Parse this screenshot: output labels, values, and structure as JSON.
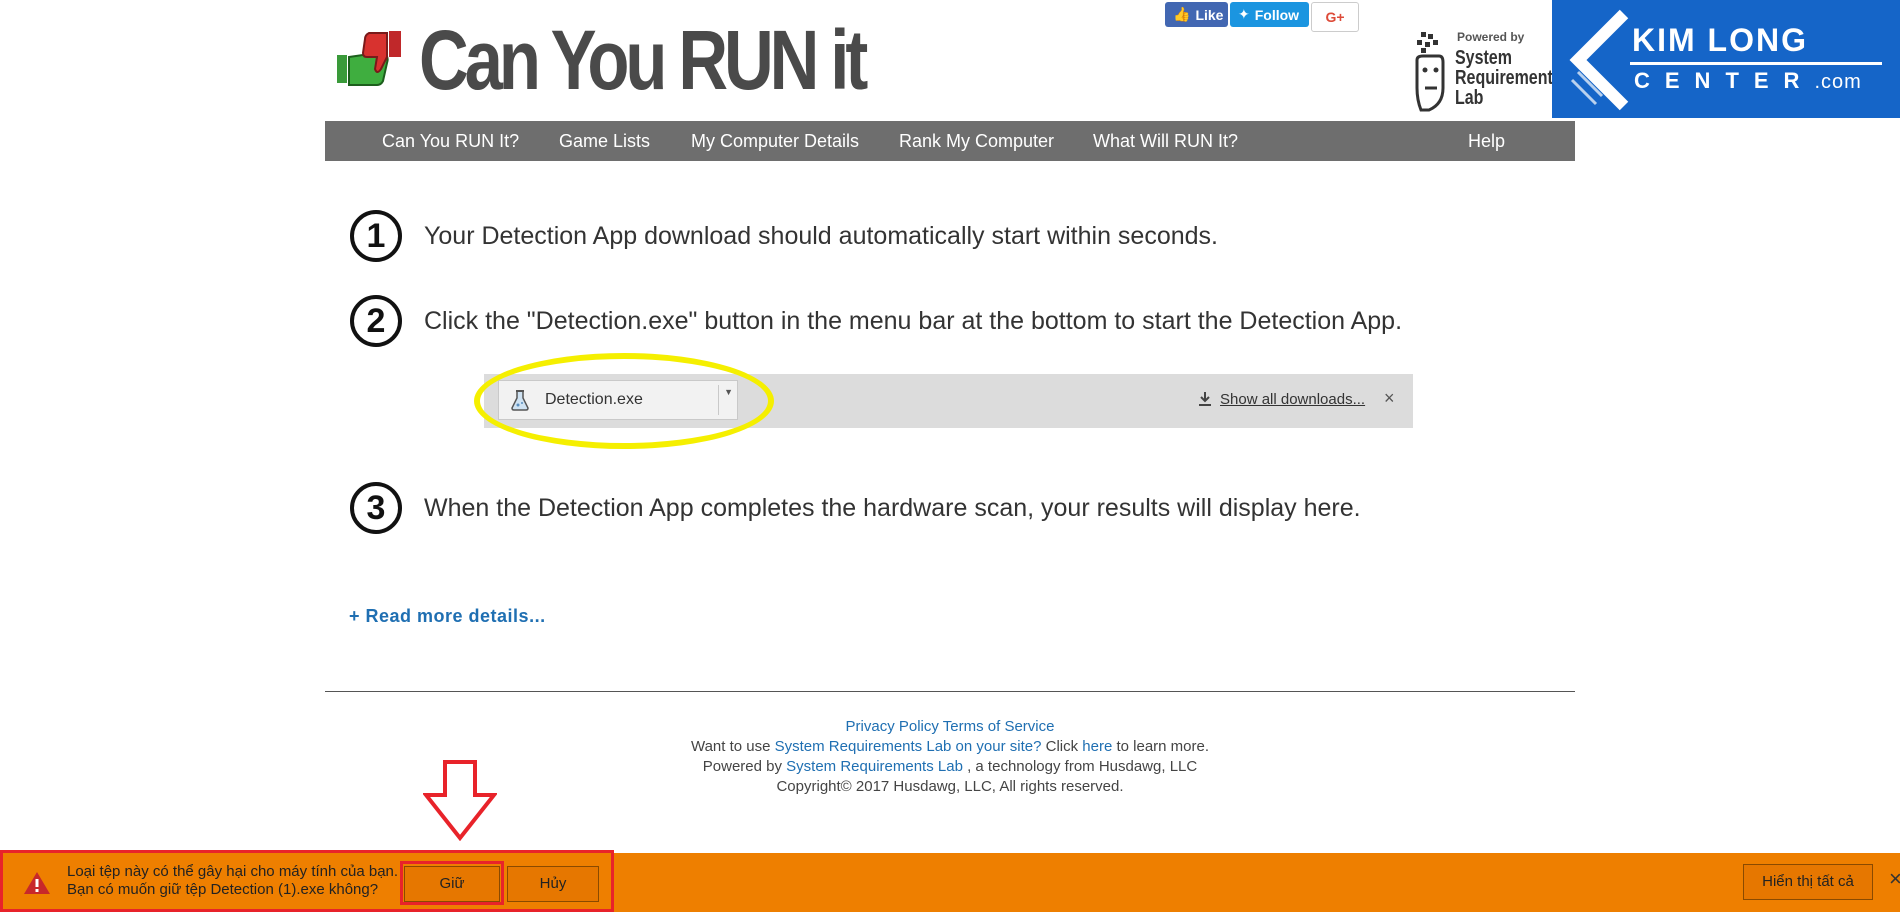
{
  "header": {
    "logo_text": "Can You RUN it",
    "social": {
      "like": "Like",
      "follow": "Follow",
      "gplus": "G+"
    },
    "srl": {
      "powered": "Powered by",
      "line1": "System",
      "line2": "Requirements",
      "line3": "Lab"
    },
    "kimlong": {
      "title": "KIM LONG",
      "sub": "CENTER",
      "com": ".com"
    }
  },
  "nav": {
    "items": [
      "Can You RUN It?",
      "Game Lists",
      "My Computer Details",
      "Rank My Computer",
      "What Will RUN It?",
      "Help"
    ]
  },
  "steps": [
    {
      "num": "1",
      "text": "Your Detection App download should automatically start within seconds."
    },
    {
      "num": "2",
      "text": "Click the \"Detection.exe\" button in the menu bar at the bottom to start the Detection App."
    },
    {
      "num": "3",
      "text": "When the Detection App completes the hardware scan, your results will display here."
    }
  ],
  "download_bar_image": {
    "file": "Detection.exe",
    "show_all": "Show all downloads...",
    "close": "×"
  },
  "read_more": "+ Read more details...",
  "footer": {
    "privacy": "Privacy Policy",
    "terms": "Terms of Service",
    "line2_pre": "Want to use ",
    "line2_link": "System Requirements Lab on your site?",
    "line2_mid": " Click ",
    "line2_here": "here",
    "line2_post": " to learn more.",
    "line3_pre": "Powered by ",
    "line3_link": "System Requirements Lab",
    "line3_post": " , a technology from Husdawg, LLC",
    "copyright": "Copyright© 2017 Husdawg, LLC, All rights reserved."
  },
  "download_warning": {
    "line1": "Loại tệp này có thể gây hại cho máy tính của bạn.",
    "line2": "Bạn có muốn giữ tệp Detection (1).exe không?",
    "keep": "Giữ",
    "cancel": "Hủy",
    "show_all": "Hiển thị tất cả",
    "close": "×"
  },
  "colors": {
    "nav_bg": "#6e6e6e",
    "bottom_bar": "#ee7f00",
    "highlight_red": "#e8232a",
    "ellipse_yellow": "#f5ef00",
    "link_blue": "#1f6fb2",
    "kimlong_blue": "#1565c8"
  }
}
